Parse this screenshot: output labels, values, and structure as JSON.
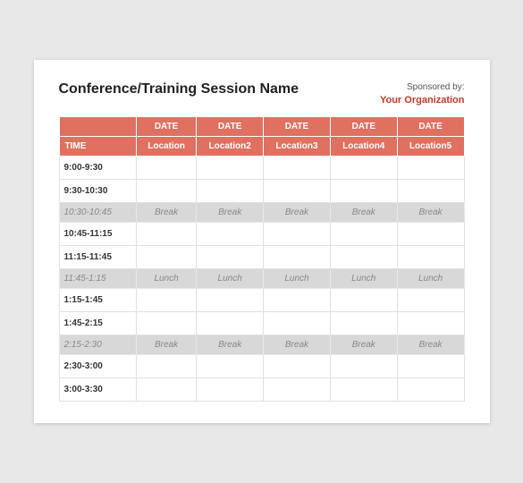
{
  "header": {
    "title": "Conference/Training Session Name",
    "sponsor_label": "Sponsored by:",
    "sponsor_name": "Your Organization"
  },
  "table": {
    "date_row": [
      "",
      "DATE",
      "DATE",
      "DATE",
      "DATE",
      "DATE"
    ],
    "location_row": [
      "TIME",
      "Location",
      "Location2",
      "Location3",
      "Location4",
      "Location5"
    ],
    "rows": [
      {
        "type": "normal",
        "time": "9:00-9:30",
        "cells": [
          "",
          "",
          "",
          "",
          ""
        ]
      },
      {
        "type": "normal",
        "time": "9:30-10:30",
        "cells": [
          "",
          "",
          "",
          "",
          ""
        ]
      },
      {
        "type": "break",
        "time": "10:30-10:45",
        "cells": [
          "Break",
          "Break",
          "Break",
          "Break",
          "Break"
        ]
      },
      {
        "type": "normal",
        "time": "10:45-11:15",
        "cells": [
          "",
          "",
          "",
          "",
          ""
        ]
      },
      {
        "type": "normal",
        "time": "11:15-11:45",
        "cells": [
          "",
          "",
          "",
          "",
          ""
        ]
      },
      {
        "type": "lunch",
        "time": "11:45-1:15",
        "cells": [
          "Lunch",
          "Lunch",
          "Lunch",
          "Lunch",
          "Lunch"
        ]
      },
      {
        "type": "normal",
        "time": "1:15-1:45",
        "cells": [
          "",
          "",
          "",
          "",
          ""
        ]
      },
      {
        "type": "normal",
        "time": "1:45-2:15",
        "cells": [
          "",
          "",
          "",
          "",
          ""
        ]
      },
      {
        "type": "break",
        "time": "2:15-2:30",
        "cells": [
          "Break",
          "Break",
          "Break",
          "Break",
          "Break"
        ]
      },
      {
        "type": "normal",
        "time": "2:30-3:00",
        "cells": [
          "",
          "",
          "",
          "",
          ""
        ]
      },
      {
        "type": "normal",
        "time": "3:00-3:30",
        "cells": [
          "",
          "",
          "",
          "",
          ""
        ]
      }
    ]
  }
}
